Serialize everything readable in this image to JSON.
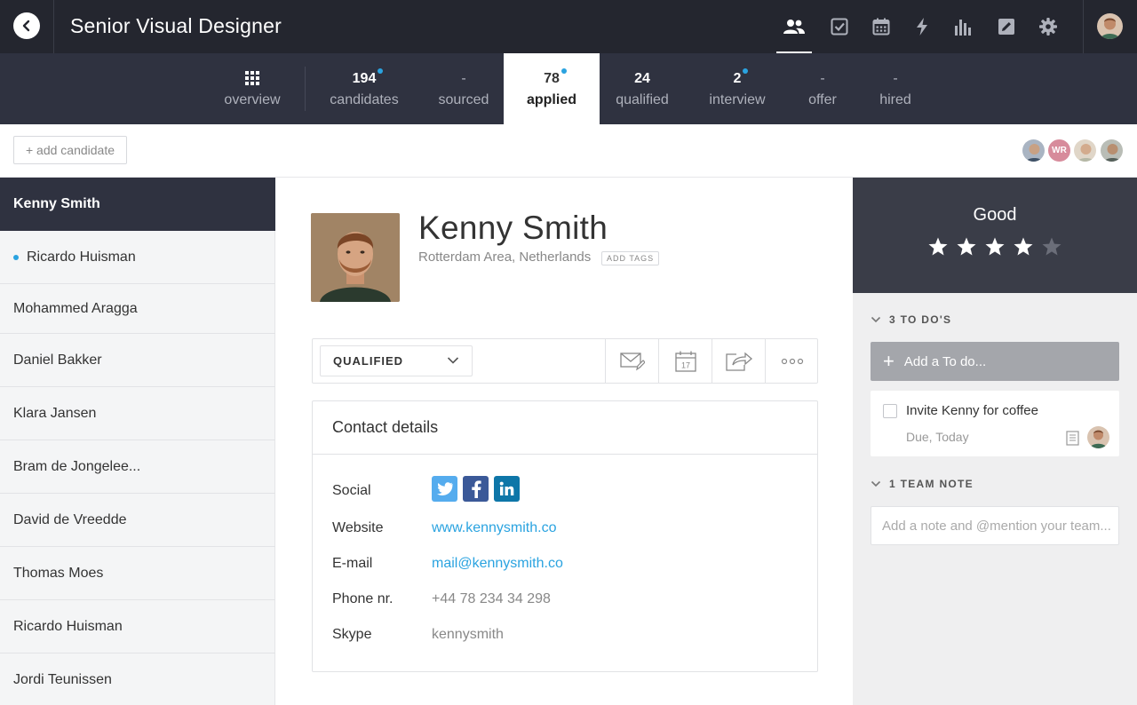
{
  "header": {
    "job_title": "Senior Visual Designer",
    "icons": [
      "people-icon",
      "checklist-icon",
      "calendar-icon",
      "bolt-icon",
      "bar-chart-icon",
      "edit-icon",
      "gear-icon"
    ]
  },
  "pipeline": {
    "overview_label": "overview",
    "stages": [
      {
        "count": "194",
        "label": "candidates",
        "new": true
      },
      {
        "count": "-",
        "label": "sourced",
        "new": false
      },
      {
        "count": "78",
        "label": "applied",
        "new": true,
        "active": true
      },
      {
        "count": "24",
        "label": "qualified",
        "new": false
      },
      {
        "count": "2",
        "label": "interview",
        "new": true
      },
      {
        "count": "-",
        "label": "offer",
        "new": false
      },
      {
        "count": "-",
        "label": "hired",
        "new": false
      }
    ]
  },
  "actions": {
    "add_candidate": "+ add candidate",
    "team_initials": "WR"
  },
  "candidates": [
    {
      "name": "Kenny Smith",
      "selected": true
    },
    {
      "name": "Ricardo Huisman",
      "unread": true
    },
    {
      "name": "Mohammed Aragga"
    },
    {
      "name": "Daniel Bakker"
    },
    {
      "name": "Klara Jansen"
    },
    {
      "name": "Bram de Jongelee..."
    },
    {
      "name": "David de Vreedde"
    },
    {
      "name": "Thomas Moes"
    },
    {
      "name": "Ricardo Huisman"
    },
    {
      "name": "Jordi Teunissen"
    }
  ],
  "profile": {
    "name": "Kenny Smith",
    "location": "Rotterdam Area, Netherlands",
    "add_tags": "ADD TAGS",
    "status": "QUALIFIED"
  },
  "contact": {
    "title": "Contact details",
    "social_label": "Social",
    "website_label": "Website",
    "website": "www.kennysmith.co",
    "email_label": "E-mail",
    "email": "mail@kennysmith.co",
    "phone_label": "Phone nr.",
    "phone": "+44 78 234 34 298",
    "skype_label": "Skype",
    "skype": "kennysmith"
  },
  "rating": {
    "label": "Good",
    "stars": 4,
    "max": 5
  },
  "todos": {
    "header": "3 TO DO'S",
    "add_label": "Add a To do...",
    "items": [
      {
        "text": "Invite Kenny for coffee",
        "due": "Due, Today"
      }
    ]
  },
  "notes": {
    "header": "1 TEAM NOTE",
    "placeholder": "Add a note and @mention your team..."
  },
  "colors": {
    "dark_bar": "#24262f",
    "pipeline_bar": "#2f3240",
    "accent": "#2aa3e0",
    "twitter": "#55acee",
    "facebook": "#3b5998",
    "linkedin": "#0e76a8"
  }
}
